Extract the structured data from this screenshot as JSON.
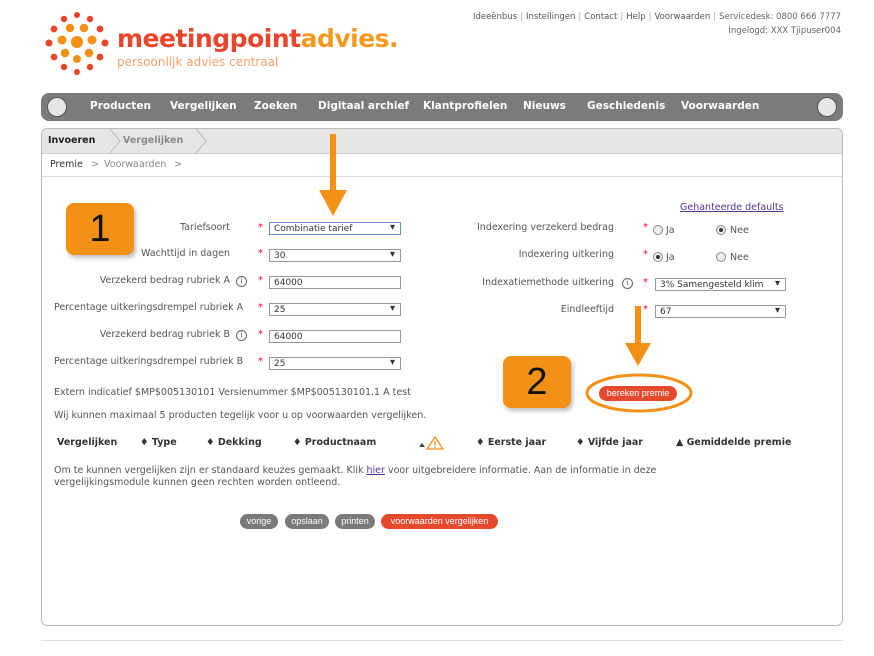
{
  "brand": {
    "name_part1": "meetingpoint",
    "name_part2": "advies.",
    "tagline": "persoonlijk advies centraal",
    "accent": "#e8452c",
    "orange": "#f39116"
  },
  "top_links": [
    "Ideeënbus",
    "Instellingen",
    "Contact",
    "Help",
    "Voorwaarden",
    "Servicedesk: 0800 666 7777"
  ],
  "logged_in": "Ingelogd: XXX Tjipuser004",
  "nav": {
    "home_icon": "home-icon",
    "items": [
      "Producten",
      "Vergelijken",
      "Zoeken",
      "Digitaal archief",
      "Klantprofielen",
      "Nieuws",
      "Geschiedenis",
      "Voorwaarden"
    ],
    "right_icon": "ball-icon"
  },
  "tabs": [
    "Invoeren",
    "Vergelijken"
  ],
  "breadcrumb": [
    "Premie",
    ">",
    "Voorwaarden",
    ">"
  ],
  "defaults_link": "Gehanteerde defaults",
  "form_left": [
    {
      "label": "Tariefsoort",
      "value": "Combinatie tarief",
      "type": "select"
    },
    {
      "label": "Wachttijd in dagen",
      "value": "30",
      "type": "select"
    },
    {
      "label": "Verzekerd bedrag rubriek A",
      "value": "64000",
      "type": "input",
      "info": true
    },
    {
      "label": "Percentage uitkeringsdrempel rubriek A",
      "value": "25",
      "type": "select"
    },
    {
      "label": "Verzekerd bedrag rubriek B",
      "value": "64000",
      "type": "input",
      "info": true
    },
    {
      "label": "Percentage uitkeringsdrempel rubriek B",
      "value": "25",
      "type": "select"
    }
  ],
  "form_right": {
    "indexering_verzekerd": {
      "label": "Indexering verzekerd bedrag",
      "opt1": "Ja",
      "opt2": "Nee",
      "selected": "Nee"
    },
    "indexering_uitkering": {
      "label": "Indexering uitkering",
      "opt1": "Ja",
      "opt2": "Nee",
      "selected": "Ja"
    },
    "indexatiemethode": {
      "label": "Indexatiemethode uitkering",
      "value": "3% Samengesteld klim"
    },
    "eindleeftijd": {
      "label": "Eindleeftijd",
      "value": "67"
    }
  },
  "required_mark": "*",
  "info_glyph": "i",
  "extern_text": "Extern indicatief $MP$005130101 Versienummer $MP$005130101.1 A test",
  "max_text": "Wij kunnen maximaal 5 producten tegelijk voor u op voorwaarden vergelijken.",
  "table_headers": [
    "Vergelijken",
    "Type",
    "Dekking",
    "Productnaam",
    "Eerste jaar",
    "Vijfde jaar",
    "Gemiddelde premie"
  ],
  "sort_glyph": "♦",
  "note_text_1": "Om te kunnen vergelijken zijn er standaard keuzes gemaakt. Klik ",
  "note_link": "hier",
  "note_text_2": " voor uitgebreidere informatie. Aan de informatie in deze",
  "note_text_3": "vergelijkingsmodule kunnen geen rechten worden ontleend.",
  "buttons": {
    "bereken": "bereken premie",
    "vorige": "vorige",
    "opslaan": "opslaan",
    "printen": "printen",
    "vergelijken": "voorwaarden vergelijken"
  },
  "steps": [
    "1",
    "2"
  ]
}
